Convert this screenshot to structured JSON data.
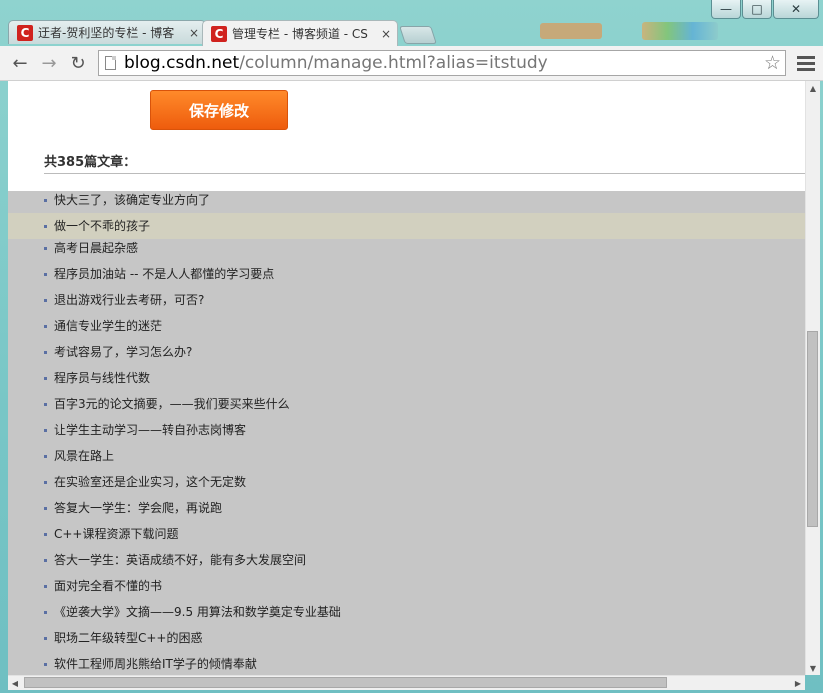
{
  "window": {
    "minimize": "—",
    "maximize": "□",
    "close": "✕"
  },
  "tabs": [
    {
      "favicon": "C",
      "title": "迂者-贺利坚的专栏 - 博客",
      "close": "×"
    },
    {
      "favicon": "C",
      "title": "管理专栏 - 博客频道 - CS",
      "close": "×"
    }
  ],
  "toolbar": {
    "back": "←",
    "forward": "→",
    "reload": "↻",
    "url_host": "blog.csdn.net",
    "url_path": "/column/manage.html?alias=itstudy",
    "star": "☆"
  },
  "page": {
    "save_button": "保存修改",
    "article_count": "共385篇文章：",
    "articles": [
      "快大三了，该确定专业方向了",
      "做一个不乖的孩子",
      "高考日晨起杂感",
      "程序员加油站 -- 不是人人都懂的学习要点",
      "退出游戏行业去考研，可否?",
      "通信专业学生的迷茫",
      "考试容易了，学习怎么办?",
      "程序员与线性代数",
      "百字3元的论文摘要，——我们要买来些什么",
      "让学生主动学习——转自孙志岗博客",
      "风景在路上",
      "在实验室还是企业实习，这个无定数",
      "答复大一学生：学会爬，再说跑",
      "C++课程资源下载问题",
      "答大一学生：英语成绩不好，能有多大发展空间",
      "面对完全看不懂的书",
      "《逆袭大学》文摘——9.5 用算法和数学奠定专业基础",
      "职场二年级转型C++的困惑",
      "软件工程师周兆熊给IT学子的倾情奉献"
    ],
    "highlighted_index": 1
  },
  "scrollbars": {
    "up": "▲",
    "down": "▼",
    "left": "◀",
    "right": "▶"
  }
}
